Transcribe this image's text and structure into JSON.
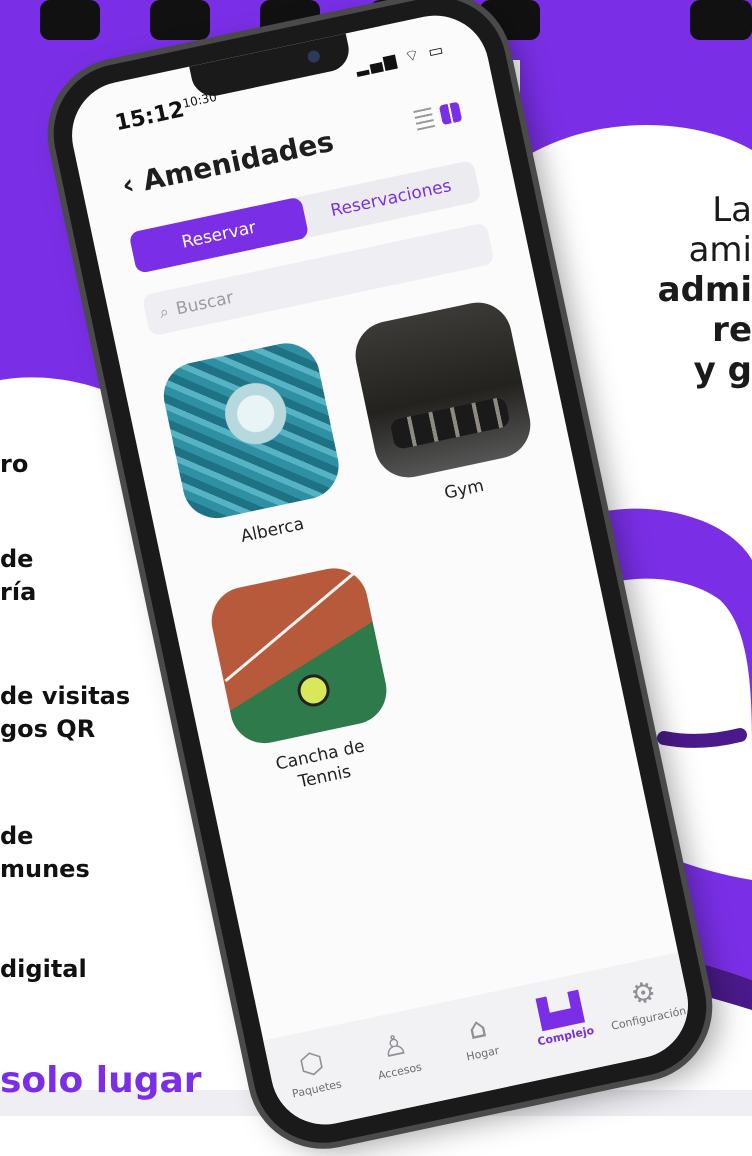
{
  "left_list": [
    "ro",
    "de",
    "ría",
    "de visitas",
    "gos QR",
    "de",
    "munes",
    "digital"
  ],
  "tagline": "solo lugar",
  "right_text": {
    "line1": "La",
    "line2": "ami",
    "line3": "admi",
    "line4": "re",
    "line5": "y g"
  },
  "status": {
    "time": "15:12",
    "time_small": "10:30"
  },
  "nav": {
    "back": "‹",
    "title": "Amenidades"
  },
  "segments": {
    "reservar": "Reservar",
    "reservaciones": "Reservaciones"
  },
  "search": {
    "placeholder": "Buscar"
  },
  "amenities": [
    {
      "label": "Alberca"
    },
    {
      "label": "Gym"
    },
    {
      "label": "Cancha de\nTennis"
    }
  ],
  "tabbar": [
    {
      "label": "Paquetes",
      "icon": "package-icon"
    },
    {
      "label": "Accesos",
      "icon": "user-key-icon"
    },
    {
      "label": "Hogar",
      "icon": "home-icon"
    },
    {
      "label": "Complejo",
      "icon": "buildings-icon"
    },
    {
      "label": "Configuración",
      "icon": "gear-icon"
    }
  ],
  "colors": {
    "accent": "#7a2fe6",
    "dark_purple": "#4a1a8a"
  }
}
